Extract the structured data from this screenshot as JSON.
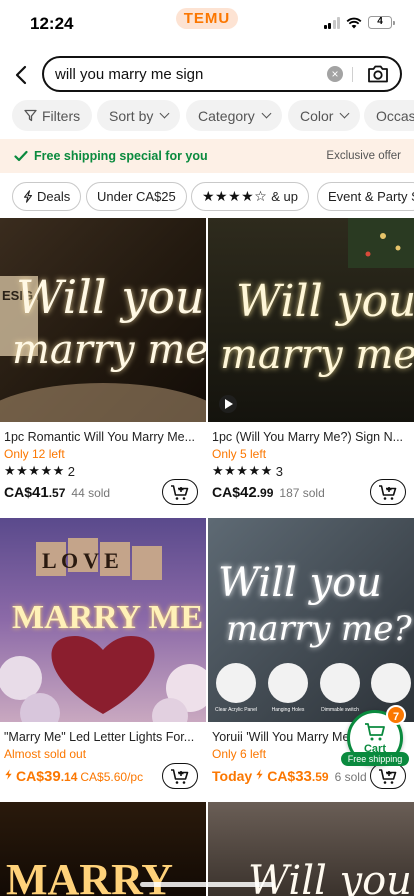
{
  "status_bar": {
    "time": "12:24",
    "brand": "TEMU",
    "battery": "4"
  },
  "search": {
    "query": "will you marry me sign"
  },
  "filters": [
    {
      "label": "Filters"
    },
    {
      "label": "Sort by"
    },
    {
      "label": "Category"
    },
    {
      "label": "Color"
    },
    {
      "label": "Occas"
    }
  ],
  "promo": {
    "left_text": "Free shipping special for you",
    "right_text": "Exclusive offer"
  },
  "quick_chips": [
    {
      "label": "Deals"
    },
    {
      "label": "Under CA$25"
    },
    {
      "label": "& up",
      "stars": "★★★★☆"
    },
    {
      "label": "Event & Party S"
    }
  ],
  "products": [
    {
      "title": "1pc Romantic Will You Marry Me...",
      "stock": "Only 12 left",
      "stars": "★★★★★",
      "reviews": "2",
      "currency": "CA$",
      "price_main": "41",
      "price_cents": ".57",
      "sold": "44 sold"
    },
    {
      "title": "1pc (Will You Marry Me?) Sign N...",
      "stock": "Only 5 left",
      "stars": "★★★★★",
      "reviews": "3",
      "currency": "CA$",
      "price_main": "42",
      "price_cents": ".99",
      "sold": "187 sold"
    },
    {
      "title": "\"Marry Me\" Led Letter Lights For...",
      "stock": "Almost sold out",
      "currency": "CA$",
      "price_main": "39",
      "price_cents": ".14",
      "unit_price": "CA$5.60/pc"
    },
    {
      "title": "Yoruii 'Will You Marry Me...",
      "stock": "Only 6 left",
      "prefix": "Today",
      "currency": "CA$",
      "price_main": "33",
      "price_cents": ".59",
      "sold": "6 sold"
    }
  ],
  "image_text": {
    "neon_line1": "Will you",
    "neon_line2": "marry me?",
    "love": "L O V E",
    "marry_me": "MARRY ME",
    "marry": "MARRY",
    "box_sign": "ESIG DEAR",
    "feature_labels": [
      "Clear Acrylic Panel",
      "Hanging Holes",
      "Dimmable switch",
      ""
    ]
  },
  "floating_cart": {
    "label": "Cart",
    "count": "7",
    "free_shipping": "Free shipping"
  },
  "colors": {
    "accent": "#fb7701",
    "green": "#0a8a3e"
  }
}
